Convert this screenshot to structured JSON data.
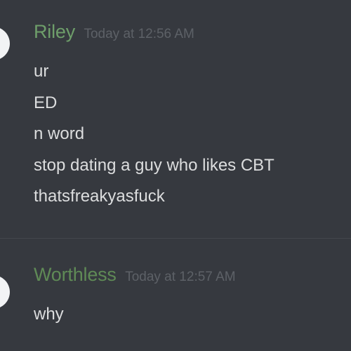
{
  "messages": [
    {
      "username": "Riley",
      "username_color": "#6e9e6a",
      "timestamp": "Today at 12:56 AM",
      "lines": [
        "ur",
        "ED",
        "n word",
        "stop dating a guy who likes CBT",
        "thatsfreakyasfuck"
      ]
    },
    {
      "username": "Worthless",
      "username_color": "#5f8a56",
      "timestamp": "Today at 12:57 AM",
      "lines": [
        "why"
      ]
    }
  ],
  "colors": {
    "background": "#36393f",
    "message_text": "#dcddde",
    "timestamp": "#5d6167",
    "divider": "#43464c"
  }
}
